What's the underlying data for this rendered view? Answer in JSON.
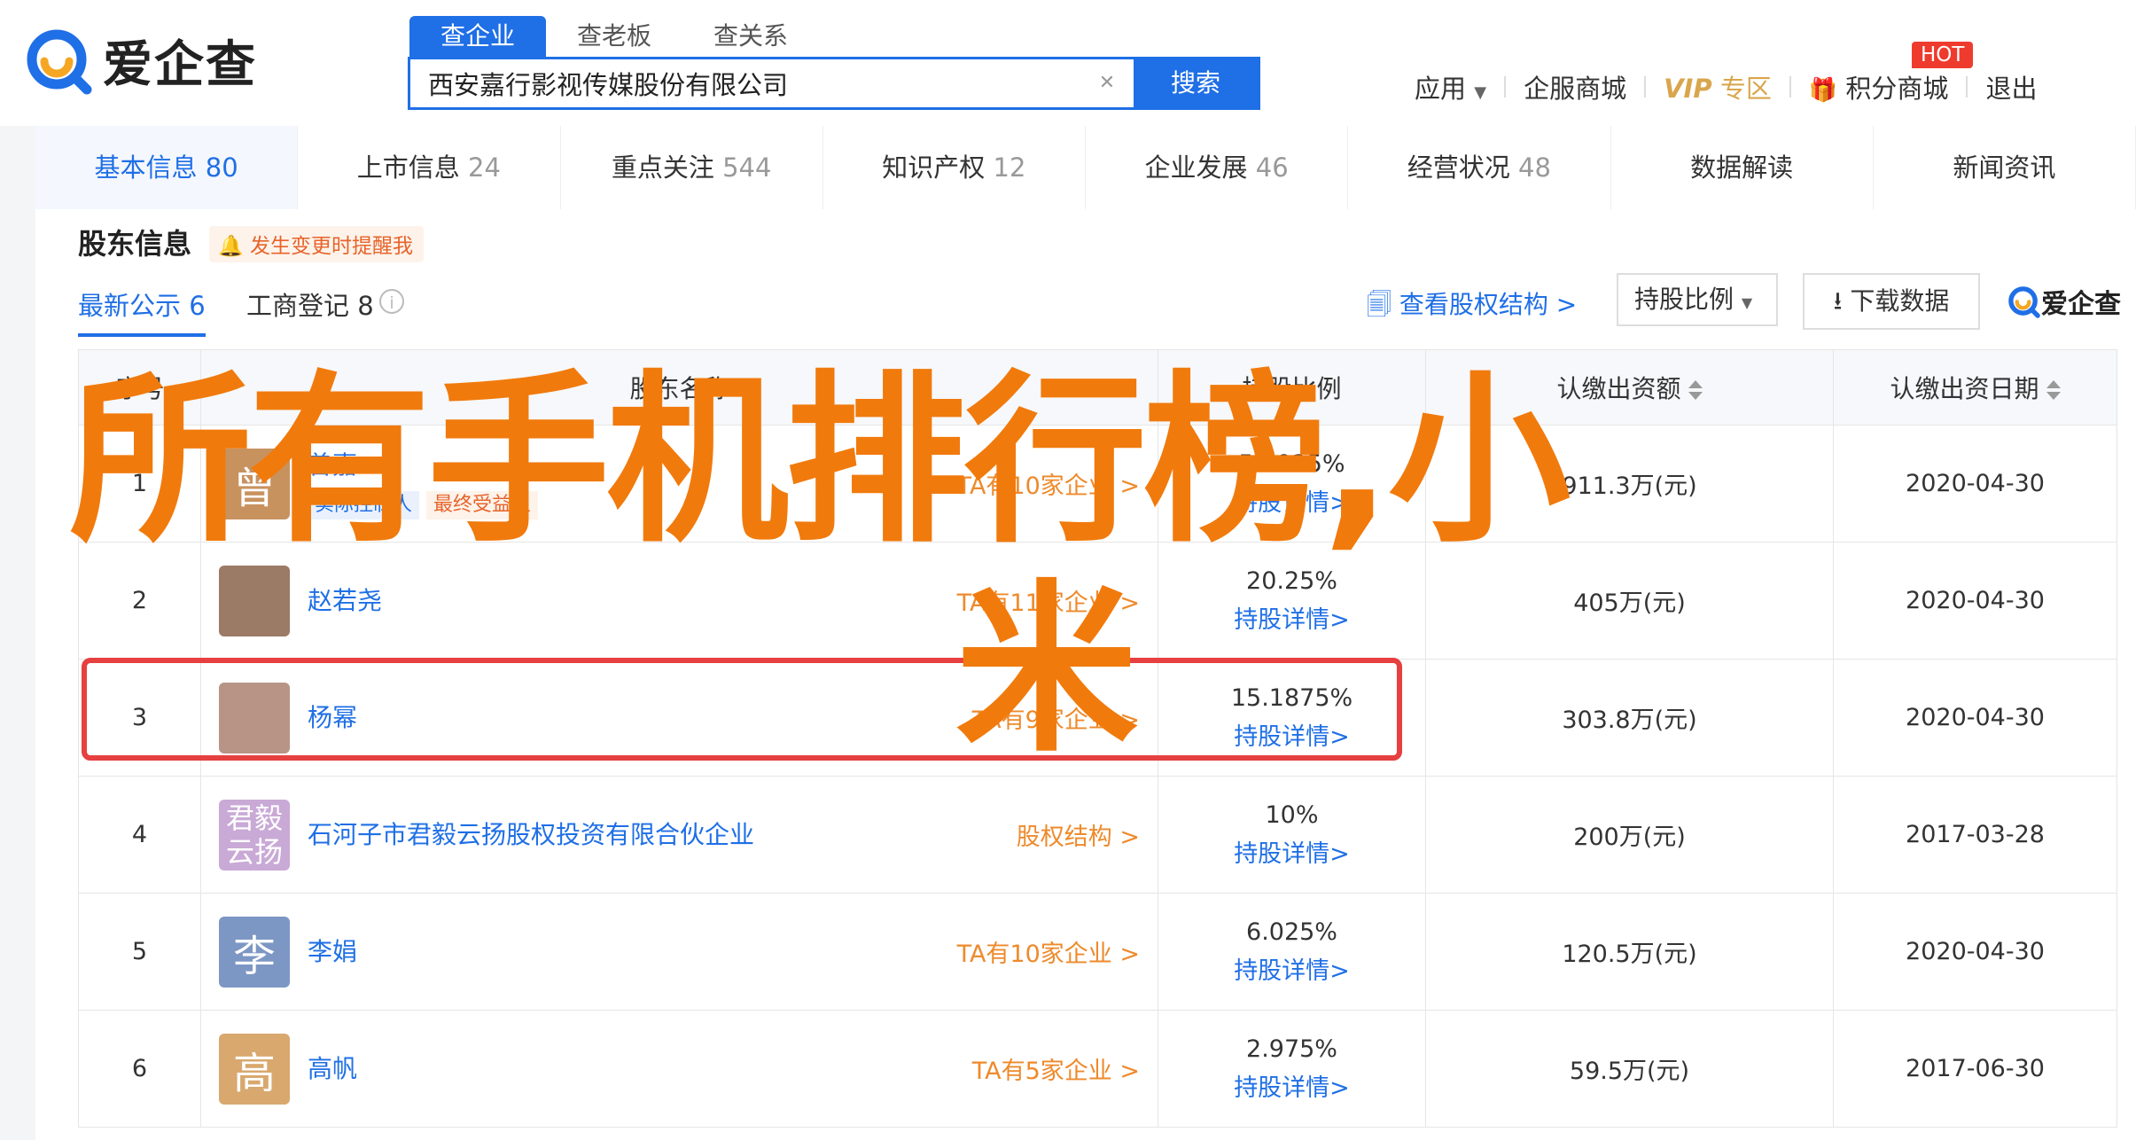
{
  "brand": {
    "name": "爱企查"
  },
  "search": {
    "tabs": [
      "查企业",
      "查老板",
      "查关系"
    ],
    "query": "西安嘉行影视传媒股份有限公司",
    "button_label": "搜索",
    "clear_icon": "close-icon"
  },
  "topnav": {
    "apps": "应用",
    "service_mall": "企服商城",
    "vip_label": "VIP",
    "vip_area": "专区",
    "points_mall": "积分商城",
    "hot_badge": "HOT",
    "truncated": "退出"
  },
  "categories": [
    {
      "label": "基本信息",
      "count": "80"
    },
    {
      "label": "上市信息",
      "count": "24"
    },
    {
      "label": "重点关注",
      "count": "544"
    },
    {
      "label": "知识产权",
      "count": "12"
    },
    {
      "label": "企业发展",
      "count": "46"
    },
    {
      "label": "经营状况",
      "count": "48"
    },
    {
      "label": "数据解读",
      "count": ""
    },
    {
      "label": "新闻资讯",
      "count": ""
    }
  ],
  "shareholders": {
    "title": "股东信息",
    "remind": "发生变更时提醒我",
    "tabs": [
      {
        "label": "最新公示",
        "count": "6"
      },
      {
        "label": "工商登记",
        "count": "8"
      }
    ],
    "equity_link": "查看股权结构 >",
    "ratio_dropdown": "持股比例",
    "download": "下载数据",
    "brand_mini": "爱企查",
    "columns": [
      "序号",
      "股东名称",
      "持股比例",
      "认缴出资额",
      "认缴出资日期"
    ],
    "rows": [
      {
        "idx": "1",
        "name": "曾嘉",
        "tags": [
          "实际控制人",
          "最终受益人"
        ],
        "link": "TA有10家企业 >",
        "ratio": "5.5925%",
        "detail": "持股详情>",
        "amount": "911.3万(元)",
        "date": "2020-04-30",
        "avatar_color": "#c8925f",
        "avatar_text": "曾"
      },
      {
        "idx": "2",
        "name": "赵若尧",
        "tags": [],
        "link": "TA有11家企业 >",
        "ratio": "20.25%",
        "detail": "持股详情>",
        "amount": "405万(元)",
        "date": "2020-04-30",
        "avatar_color": "#9b7a66",
        "avatar_text": ""
      },
      {
        "idx": "3",
        "name": "杨幂",
        "tags": [],
        "link": "TA有9家企业 >",
        "ratio": "15.1875%",
        "detail": "持股详情>",
        "amount": "303.8万(元)",
        "date": "2020-04-30",
        "avatar_color": "#b89486",
        "avatar_text": ""
      },
      {
        "idx": "4",
        "name": "石河子市君毅云扬股权投资有限合伙企业",
        "tags": [],
        "link": "股权结构 >",
        "ratio": "10%",
        "detail": "持股详情>",
        "amount": "200万(元)",
        "date": "2017-03-28",
        "avatar_color": "#c9a9d6",
        "avatar_text": "君毅云扬"
      },
      {
        "idx": "5",
        "name": "李娟",
        "tags": [],
        "link": "TA有10家企业 >",
        "ratio": "6.025%",
        "detail": "持股详情>",
        "amount": "120.5万(元)",
        "date": "2020-04-30",
        "avatar_color": "#7d97c4",
        "avatar_text": "李"
      },
      {
        "idx": "6",
        "name": "高帆",
        "tags": [],
        "link": "TA有5家企业 >",
        "ratio": "2.975%",
        "detail": "持股详情>",
        "amount": "59.5万(元)",
        "date": "2017-06-30",
        "avatar_color": "#d9a86e",
        "avatar_text": "高"
      }
    ]
  },
  "overlay": {
    "line1": "所有手机排行榜,小",
    "line2": "米",
    "color": "#f17a0c",
    "highlight_color": "#e64040"
  }
}
